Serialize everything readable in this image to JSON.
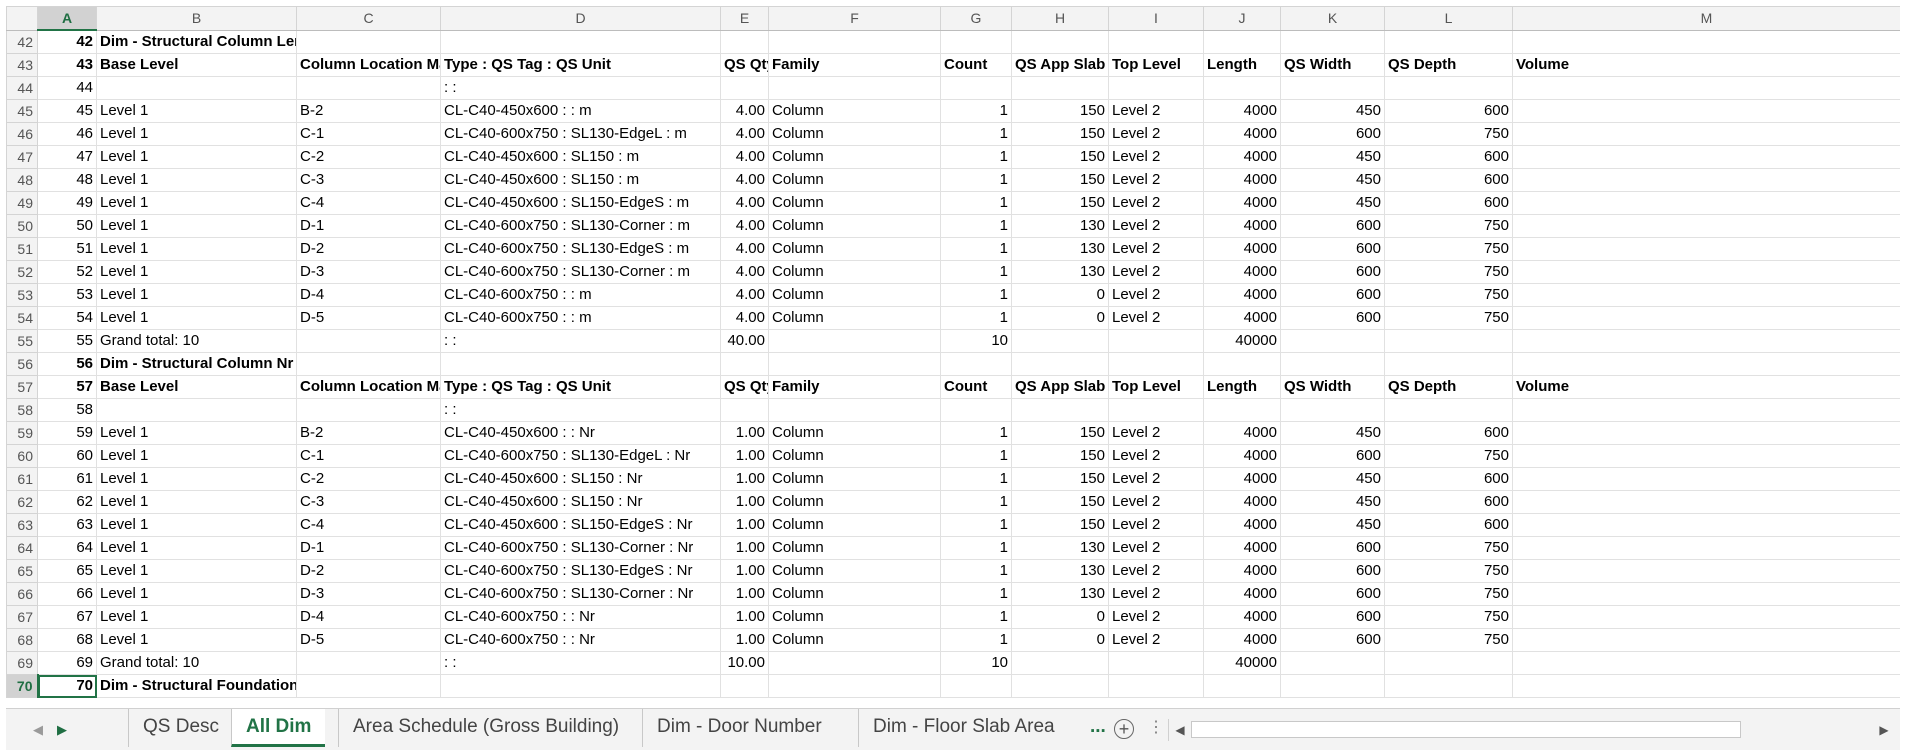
{
  "columns": [
    "A",
    "B",
    "C",
    "D",
    "E",
    "F",
    "G",
    "H",
    "I",
    "J",
    "K",
    "L",
    "M"
  ],
  "rows": [
    {
      "n": "42",
      "cells": {
        "A": "42",
        "B": "Dim - Structural Column Length"
      },
      "bold": true
    },
    {
      "n": "43",
      "cells": {
        "A": "43",
        "B": "Base Level",
        "C": "Column Location Mark",
        "D": "Type : QS Tag : QS Unit",
        "E": "QS Qty",
        "F": "Family",
        "G": "Count",
        "H": "QS App Slab Tk",
        "I": "Top Level",
        "J": "Length",
        "K": "QS Width",
        "L": "QS Depth",
        "M": "Volume"
      },
      "bold": true
    },
    {
      "n": "44",
      "cells": {
        "A": "44",
        "D": ": :"
      }
    },
    {
      "n": "45",
      "cells": {
        "A": "45",
        "B": "Level 1",
        "C": "B-2",
        "D": "CL-C40-450x600 :  : m",
        "E": "4.00",
        "F": "Column",
        "G": "1",
        "H": "150",
        "I": "Level 2",
        "J": "4000",
        "K": "450",
        "L": "600"
      }
    },
    {
      "n": "46",
      "cells": {
        "A": "46",
        "B": "Level 1",
        "C": "C-1",
        "D": "CL-C40-600x750 : SL130-EdgeL : m",
        "E": "4.00",
        "F": "Column",
        "G": "1",
        "H": "150",
        "I": "Level 2",
        "J": "4000",
        "K": "600",
        "L": "750"
      }
    },
    {
      "n": "47",
      "cells": {
        "A": "47",
        "B": "Level 1",
        "C": "C-2",
        "D": "CL-C40-450x600 : SL150 : m",
        "E": "4.00",
        "F": "Column",
        "G": "1",
        "H": "150",
        "I": "Level 2",
        "J": "4000",
        "K": "450",
        "L": "600"
      }
    },
    {
      "n": "48",
      "cells": {
        "A": "48",
        "B": "Level 1",
        "C": "C-3",
        "D": "CL-C40-450x600 : SL150 : m",
        "E": "4.00",
        "F": "Column",
        "G": "1",
        "H": "150",
        "I": "Level 2",
        "J": "4000",
        "K": "450",
        "L": "600"
      }
    },
    {
      "n": "49",
      "cells": {
        "A": "49",
        "B": "Level 1",
        "C": "C-4",
        "D": "CL-C40-450x600 : SL150-EdgeS : m",
        "E": "4.00",
        "F": "Column",
        "G": "1",
        "H": "150",
        "I": "Level 2",
        "J": "4000",
        "K": "450",
        "L": "600"
      }
    },
    {
      "n": "50",
      "cells": {
        "A": "50",
        "B": "Level 1",
        "C": "D-1",
        "D": "CL-C40-600x750 : SL130-Corner : m",
        "E": "4.00",
        "F": "Column",
        "G": "1",
        "H": "130",
        "I": "Level 2",
        "J": "4000",
        "K": "600",
        "L": "750"
      }
    },
    {
      "n": "51",
      "cells": {
        "A": "51",
        "B": "Level 1",
        "C": "D-2",
        "D": "CL-C40-600x750 : SL130-EdgeS : m",
        "E": "4.00",
        "F": "Column",
        "G": "1",
        "H": "130",
        "I": "Level 2",
        "J": "4000",
        "K": "600",
        "L": "750"
      }
    },
    {
      "n": "52",
      "cells": {
        "A": "52",
        "B": "Level 1",
        "C": "D-3",
        "D": "CL-C40-600x750 : SL130-Corner : m",
        "E": "4.00",
        "F": "Column",
        "G": "1",
        "H": "130",
        "I": "Level 2",
        "J": "4000",
        "K": "600",
        "L": "750"
      }
    },
    {
      "n": "53",
      "cells": {
        "A": "53",
        "B": "Level 1",
        "C": "D-4",
        "D": "CL-C40-600x750 :  : m",
        "E": "4.00",
        "F": "Column",
        "G": "1",
        "H": "0",
        "I": "Level 2",
        "J": "4000",
        "K": "600",
        "L": "750"
      }
    },
    {
      "n": "54",
      "cells": {
        "A": "54",
        "B": "Level 1",
        "C": "D-5",
        "D": "CL-C40-600x750 :  : m",
        "E": "4.00",
        "F": "Column",
        "G": "1",
        "H": "0",
        "I": "Level 2",
        "J": "4000",
        "K": "600",
        "L": "750"
      }
    },
    {
      "n": "55",
      "cells": {
        "A": "55",
        "B": "Grand total: 10",
        "D": ": :",
        "E": "40.00",
        "G": "10",
        "J": "40000"
      }
    },
    {
      "n": "56",
      "cells": {
        "A": "56",
        "B": "Dim - Structural Column Nr"
      },
      "bold": true
    },
    {
      "n": "57",
      "cells": {
        "A": "57",
        "B": "Base Level",
        "C": "Column Location Mark",
        "D": "Type : QS Tag : QS Unit",
        "E": "QS Qty",
        "F": "Family",
        "G": "Count",
        "H": "QS App Slab Tk",
        "I": "Top Level",
        "J": "Length",
        "K": "QS Width",
        "L": "QS Depth",
        "M": "Volume"
      },
      "bold": true
    },
    {
      "n": "58",
      "cells": {
        "A": "58",
        "D": ": :"
      }
    },
    {
      "n": "59",
      "cells": {
        "A": "59",
        "B": "Level 1",
        "C": "B-2",
        "D": "CL-C40-450x600 :  : Nr",
        "E": "1.00",
        "F": "Column",
        "G": "1",
        "H": "150",
        "I": "Level 2",
        "J": "4000",
        "K": "450",
        "L": "600"
      }
    },
    {
      "n": "60",
      "cells": {
        "A": "60",
        "B": "Level 1",
        "C": "C-1",
        "D": "CL-C40-600x750 : SL130-EdgeL : Nr",
        "E": "1.00",
        "F": "Column",
        "G": "1",
        "H": "150",
        "I": "Level 2",
        "J": "4000",
        "K": "600",
        "L": "750"
      }
    },
    {
      "n": "61",
      "cells": {
        "A": "61",
        "B": "Level 1",
        "C": "C-2",
        "D": "CL-C40-450x600 : SL150 : Nr",
        "E": "1.00",
        "F": "Column",
        "G": "1",
        "H": "150",
        "I": "Level 2",
        "J": "4000",
        "K": "450",
        "L": "600"
      }
    },
    {
      "n": "62",
      "cells": {
        "A": "62",
        "B": "Level 1",
        "C": "C-3",
        "D": "CL-C40-450x600 : SL150 : Nr",
        "E": "1.00",
        "F": "Column",
        "G": "1",
        "H": "150",
        "I": "Level 2",
        "J": "4000",
        "K": "450",
        "L": "600"
      }
    },
    {
      "n": "63",
      "cells": {
        "A": "63",
        "B": "Level 1",
        "C": "C-4",
        "D": "CL-C40-450x600 : SL150-EdgeS : Nr",
        "E": "1.00",
        "F": "Column",
        "G": "1",
        "H": "150",
        "I": "Level 2",
        "J": "4000",
        "K": "450",
        "L": "600"
      }
    },
    {
      "n": "64",
      "cells": {
        "A": "64",
        "B": "Level 1",
        "C": "D-1",
        "D": "CL-C40-600x750 : SL130-Corner : Nr",
        "E": "1.00",
        "F": "Column",
        "G": "1",
        "H": "130",
        "I": "Level 2",
        "J": "4000",
        "K": "600",
        "L": "750"
      }
    },
    {
      "n": "65",
      "cells": {
        "A": "65",
        "B": "Level 1",
        "C": "D-2",
        "D": "CL-C40-600x750 : SL130-EdgeS : Nr",
        "E": "1.00",
        "F": "Column",
        "G": "1",
        "H": "130",
        "I": "Level 2",
        "J": "4000",
        "K": "600",
        "L": "750"
      }
    },
    {
      "n": "66",
      "cells": {
        "A": "66",
        "B": "Level 1",
        "C": "D-3",
        "D": "CL-C40-600x750 : SL130-Corner : Nr",
        "E": "1.00",
        "F": "Column",
        "G": "1",
        "H": "130",
        "I": "Level 2",
        "J": "4000",
        "K": "600",
        "L": "750"
      }
    },
    {
      "n": "67",
      "cells": {
        "A": "67",
        "B": "Level 1",
        "C": "D-4",
        "D": "CL-C40-600x750 :  : Nr",
        "E": "1.00",
        "F": "Column",
        "G": "1",
        "H": "0",
        "I": "Level 2",
        "J": "4000",
        "K": "600",
        "L": "750"
      }
    },
    {
      "n": "68",
      "cells": {
        "A": "68",
        "B": "Level 1",
        "C": "D-5",
        "D": "CL-C40-600x750 :  : Nr",
        "E": "1.00",
        "F": "Column",
        "G": "1",
        "H": "0",
        "I": "Level 2",
        "J": "4000",
        "K": "600",
        "L": "750"
      }
    },
    {
      "n": "69",
      "cells": {
        "A": "69",
        "B": "Grand total: 10",
        "D": ": :",
        "E": "10.00",
        "G": "10",
        "J": "40000"
      }
    },
    {
      "n": "70",
      "cells": {
        "A": "70",
        "B": "Dim - Structural Foundation Nr"
      },
      "bold": true,
      "selected": true
    }
  ],
  "numeric_columns": [
    "E",
    "G",
    "H",
    "J",
    "K",
    "L"
  ],
  "active_cell": "A70",
  "sheet_tabs": [
    "QS Desc",
    "All Dim",
    "Area Schedule (Gross Building)",
    "Dim - Door Number",
    "Dim - Floor Slab Area"
  ],
  "active_tab": "All Dim",
  "more_tabs": "...",
  "icons": {
    "prev_sheet": "triangle-left-icon",
    "next_sheet": "triangle-right-icon",
    "add_sheet": "plus-circle-icon",
    "options": "vertical-dots-icon",
    "scroll_left": "scroll-left-icon",
    "scroll_right": "scroll-right-icon"
  },
  "colors": {
    "accent": "#217346",
    "header_bg": "#f3f3f3",
    "selected_header_bg": "#d2d2d2",
    "grid_line": "#e1e1e1"
  }
}
